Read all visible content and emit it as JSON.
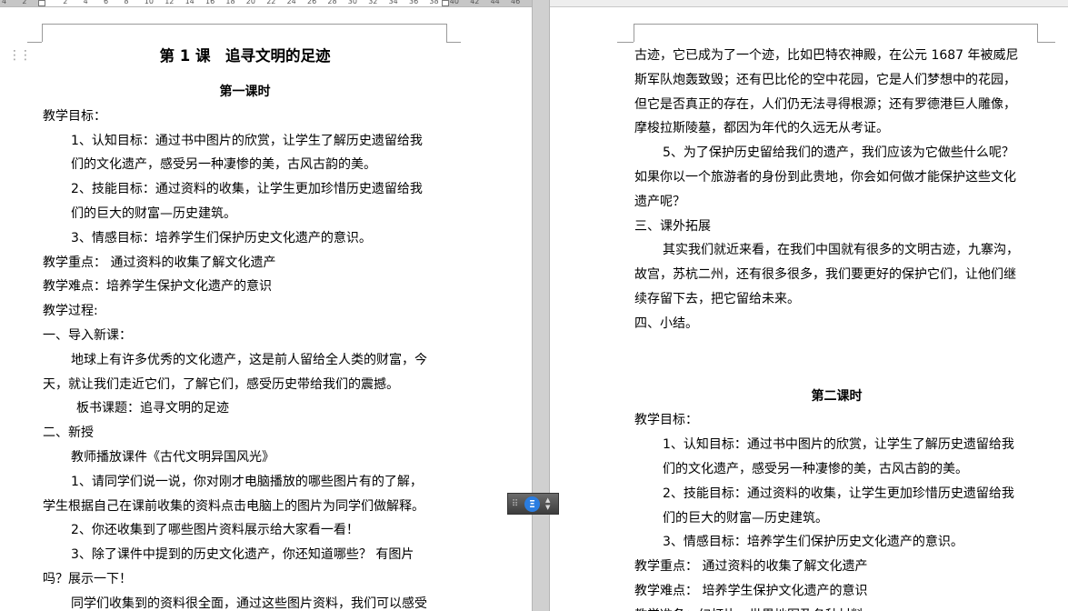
{
  "ruler": {
    "numbers": [
      "4",
      "2",
      "",
      "2",
      "4",
      "6",
      "8",
      "10",
      "12",
      "14",
      "16",
      "18",
      "20",
      "22",
      "24",
      "26",
      "28",
      "30",
      "32",
      "34",
      "36",
      "38",
      "40",
      "42",
      "44",
      "46"
    ]
  },
  "left_page": {
    "lesson_title": "第 1 课　追寻文明的足迹",
    "section_title": "第一课时",
    "lines": [
      {
        "text": "教学目标：",
        "style": "plain"
      },
      {
        "text": "1、认知目标：通过书中图片的欣赏，让学生了解历史遗留给我",
        "style": "ind1"
      },
      {
        "text": "们的文化遗产，感受另一种凄惨的美，古风古韵的美。",
        "style": "hang"
      },
      {
        "text": "2、技能目标：通过资料的收集，让学生更加珍惜历史遗留给我",
        "style": "ind1"
      },
      {
        "text": "们的巨大的财富—历史建筑。",
        "style": "hang"
      },
      {
        "text": "3、情感目标：培养学生们保护历史文化遗产的意识。",
        "style": "ind1"
      },
      {
        "text": "教学重点： 通过资料的收集了解文化遗产",
        "style": "plain"
      },
      {
        "text": "教学难点：培养学生保护文化遗产的意识",
        "style": "plain"
      },
      {
        "text": "教学过程:",
        "style": "plain"
      },
      {
        "text": "一、导入新课：",
        "style": "plain"
      },
      {
        "text": "地球上有许多优秀的文化遗产，这是前人留给全人类的财富，今",
        "style": "ind1"
      },
      {
        "text": "天，就让我们走近它们，了解它们，感受历史带给我们的震撼。",
        "style": "plain"
      },
      {
        "text": "板书课题：追寻文明的足迹",
        "style": "ind2"
      },
      {
        "text": "二、新授",
        "style": "plain"
      },
      {
        "text": "教师播放课件《古代文明异国风光》",
        "style": "ind1"
      },
      {
        "text": "1、请同学们说一说，你对刚才电脑播放的哪些图片有的了解，",
        "style": "ind1"
      },
      {
        "text": "学生根据自己在课前收集的资料点击电脑上的图片为同学们做解释。",
        "style": "plain"
      },
      {
        "text": "2、你还收集到了哪些图片资料展示给大家看一看！",
        "style": "ind1"
      },
      {
        "text": "3、除了课件中提到的历史文化遗产，你还知道哪些？ 有图片",
        "style": "ind1"
      },
      {
        "text": "吗？展示一下！",
        "style": "plain"
      },
      {
        "text": "同学们收集到的资料很全面，通过这些图片资料，我们可以感受",
        "style": "ind1"
      }
    ]
  },
  "right_page": {
    "lines_top": [
      {
        "text": "古迹，它已成为了一个迹，比如巴特农神殿，在公元 1687 年被威尼",
        "style": "plain"
      },
      {
        "text": "斯军队炮轰致毁；还有巴比伦的空中花园，它是人们梦想中的花园，",
        "style": "plain"
      },
      {
        "text": "但它是否真正的存在，人们仍无法寻得根源；还有罗德港巨人雕像，",
        "style": "plain"
      },
      {
        "text": "摩梭拉斯陵墓，都因为年代的久远无从考证。",
        "style": "plain"
      },
      {
        "text": "5、为了保护历史留给我们的遗产，我们应该为它做些什么呢？",
        "style": "ind1"
      },
      {
        "text": "如果你以一个旅游者的身份到此贵地，你会如何做才能保护这些文化",
        "style": "plain"
      },
      {
        "text": "遗产呢？",
        "style": "plain"
      },
      {
        "text": "三、课外拓展",
        "style": "plain"
      },
      {
        "text": "其实我们就近来看，在我们中国就有很多的文明古迹，九寨沟，",
        "style": "ind1"
      },
      {
        "text": "故宫，苏杭二州，还有很多很多，我们要更好的保护它们，让他们继",
        "style": "plain"
      },
      {
        "text": "续存留下去，把它留给未来。",
        "style": "plain"
      },
      {
        "text": "四、小结。",
        "style": "plain"
      }
    ],
    "section_title": "第二课时",
    "lines_bottom": [
      {
        "text": "教学目标：",
        "style": "plain"
      },
      {
        "text": "1、认知目标：通过书中图片的欣赏，让学生了解历史遗留给我",
        "style": "ind1"
      },
      {
        "text": "们的文化遗产，感受另一种凄惨的美，古风古韵的美。",
        "style": "hang"
      },
      {
        "text": "2、技能目标：通过资料的收集，让学生更加珍惜历史遗留给我",
        "style": "ind1"
      },
      {
        "text": "们的巨大的财富—历史建筑。",
        "style": "hang"
      },
      {
        "text": "3、情感目标：培养学生们保护历史文化遗产的意识。",
        "style": "ind1"
      },
      {
        "text": "教学重点： 通过资料的收集了解文化遗产",
        "style": "plain"
      },
      {
        "text": "教学难点： 培养学生保护文化遗产的意识",
        "style": "plain"
      },
      {
        "text": "教学准备：幻灯片，世界地图及各种材料",
        "style": "plain"
      }
    ]
  },
  "widget": {
    "icon": "ai-assistant-icon",
    "icon_glyph": "Ξ",
    "accent": "#2a7de1"
  }
}
